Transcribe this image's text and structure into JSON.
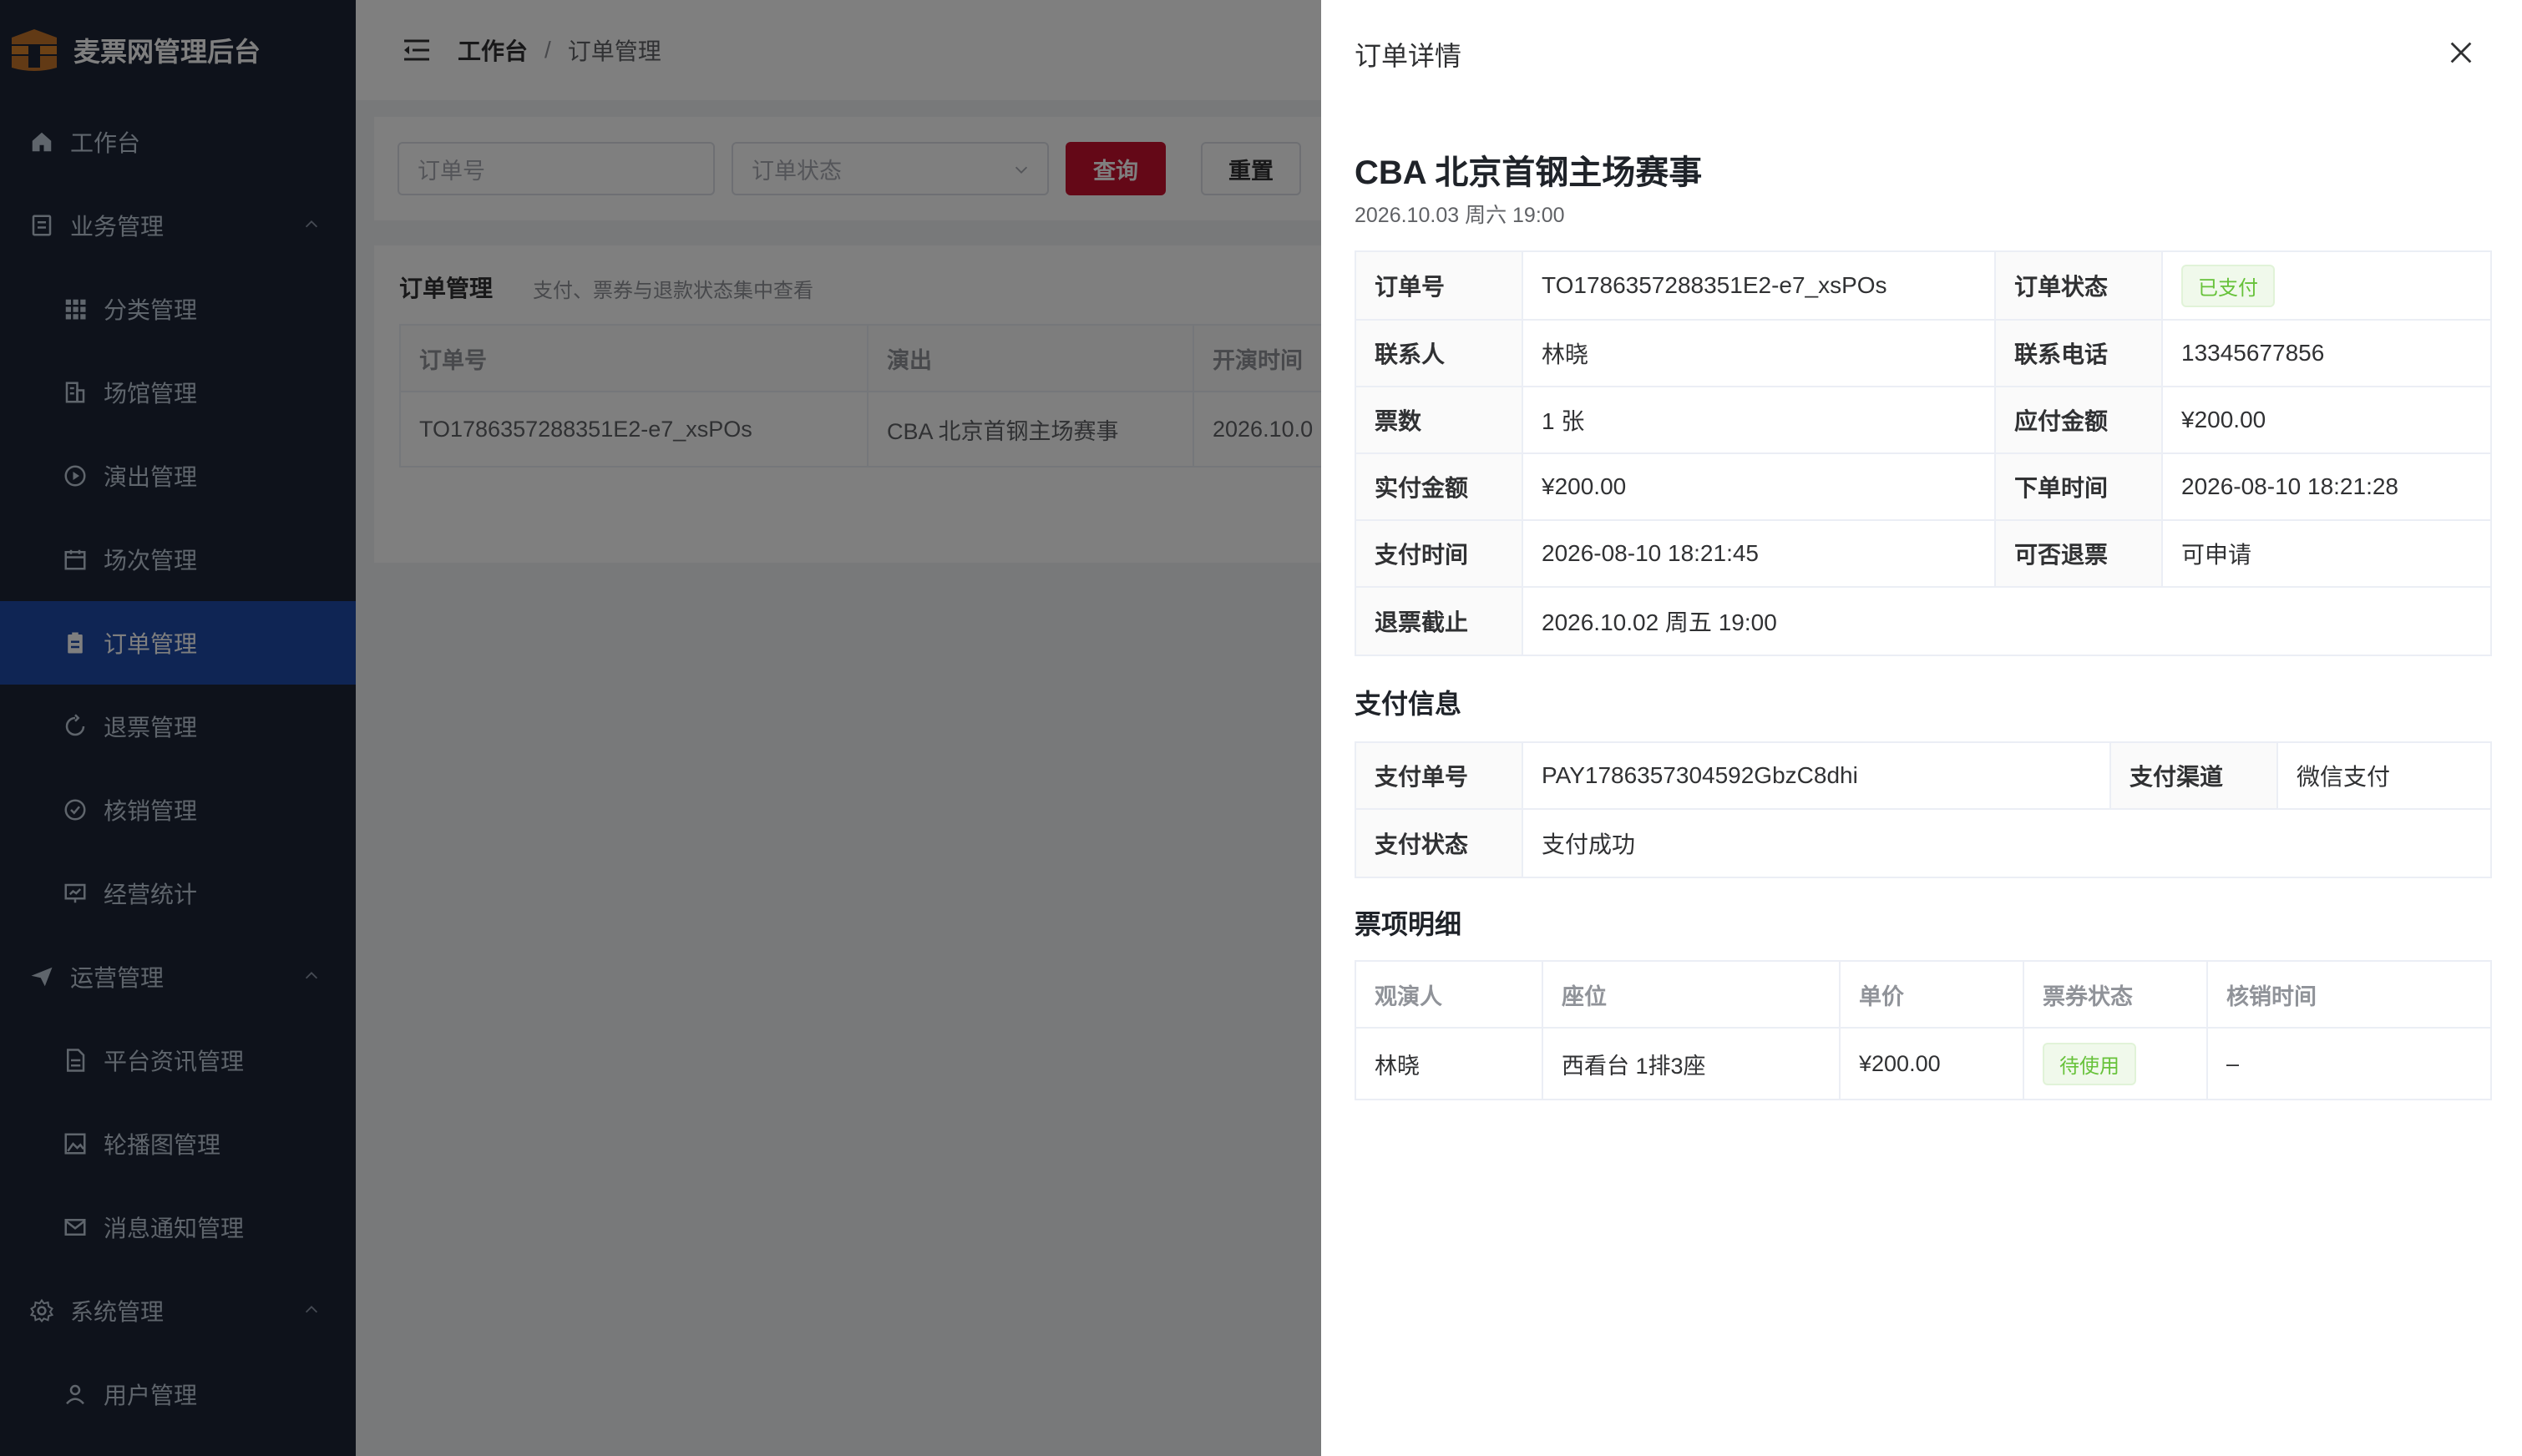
{
  "app": {
    "title": "麦票网管理后台"
  },
  "sidebar": {
    "items": [
      {
        "label": "工作台",
        "icon": "home-icon",
        "level": "top"
      },
      {
        "label": "业务管理",
        "icon": "document-icon",
        "level": "top",
        "expanded": true
      },
      {
        "label": "分类管理",
        "icon": "grid-icon",
        "level": "sub"
      },
      {
        "label": "场馆管理",
        "icon": "building-icon",
        "level": "sub"
      },
      {
        "label": "演出管理",
        "icon": "play-icon",
        "level": "sub"
      },
      {
        "label": "场次管理",
        "icon": "calendar-icon",
        "level": "sub"
      },
      {
        "label": "订单管理",
        "icon": "clipboard-icon",
        "level": "sub",
        "active": true
      },
      {
        "label": "退票管理",
        "icon": "refresh-icon",
        "level": "sub"
      },
      {
        "label": "核销管理",
        "icon": "check-circle-icon",
        "level": "sub"
      },
      {
        "label": "经营统计",
        "icon": "chart-icon",
        "level": "sub"
      },
      {
        "label": "运营管理",
        "icon": "send-icon",
        "level": "top",
        "expanded": true
      },
      {
        "label": "平台资讯管理",
        "icon": "file-icon",
        "level": "sub"
      },
      {
        "label": "轮播图管理",
        "icon": "image-icon",
        "level": "sub"
      },
      {
        "label": "消息通知管理",
        "icon": "mail-icon",
        "level": "sub"
      },
      {
        "label": "系统管理",
        "icon": "gear-icon",
        "level": "top",
        "expanded": true
      },
      {
        "label": "用户管理",
        "icon": "user-icon",
        "level": "sub"
      }
    ]
  },
  "breadcrumb": {
    "home": "工作台",
    "separator": "/",
    "current": "订单管理"
  },
  "filter": {
    "order_no_placeholder": "订单号",
    "status_placeholder": "订单状态",
    "query_label": "查询",
    "reset_label": "重置"
  },
  "list": {
    "title": "订单管理",
    "subtitle": "支付、票券与退款状态集中查看",
    "columns": [
      "订单号",
      "演出",
      "开演时间"
    ],
    "rows": [
      [
        "TO1786357288351E2-e7_xsPOs",
        "CBA 北京首钢主场赛事",
        "2026.10.0"
      ]
    ]
  },
  "drawer": {
    "title": "订单详情",
    "event_title": "CBA 北京首钢主场赛事",
    "event_time": "2026.10.03 周六 19:00",
    "order_info": {
      "order_no_label": "订单号",
      "order_no": "TO1786357288351E2-e7_xsPOs",
      "status_label": "订单状态",
      "status": "已支付",
      "contact_label": "联系人",
      "contact": "林晓",
      "phone_label": "联系电话",
      "phone": "13345677856",
      "tickets_label": "票数",
      "tickets": "1 张",
      "due_label": "应付金额",
      "due": "¥200.00",
      "paid_label": "实付金额",
      "paid": "¥200.00",
      "order_time_label": "下单时间",
      "order_time": "2026-08-10 18:21:28",
      "pay_time_label": "支付时间",
      "pay_time": "2026-08-10 18:21:45",
      "refundable_label": "可否退票",
      "refundable": "可申请",
      "refund_deadline_label": "退票截止",
      "refund_deadline": "2026.10.02 周五 19:00"
    },
    "payment": {
      "section_title": "支付信息",
      "pay_no_label": "支付单号",
      "pay_no": "PAY1786357304592GbzC8dhi",
      "channel_label": "支付渠道",
      "channel": "微信支付",
      "pay_status_label": "支付状态",
      "pay_status": "支付成功"
    },
    "tickets": {
      "section_title": "票项明细",
      "columns": [
        "观演人",
        "座位",
        "单价",
        "票券状态",
        "核销时间"
      ],
      "rows": [
        {
          "attendee": "林晓",
          "seat": "西看台 1排3座",
          "price": "¥200.00",
          "status": "待使用",
          "verify_time": "–"
        }
      ]
    }
  },
  "colors": {
    "sidebar_bg": "#1c2437",
    "active_menu": "#1e4aa8",
    "primary": "#c8102e",
    "success": "#67c23a"
  }
}
